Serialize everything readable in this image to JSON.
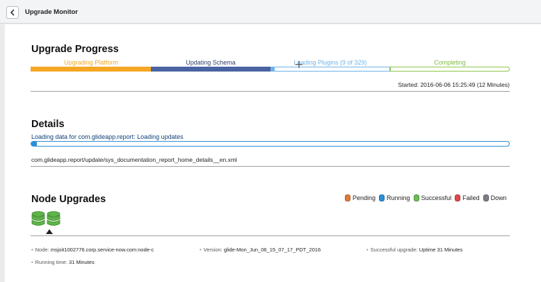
{
  "window": {
    "title": "Upgrade Monitor"
  },
  "progress": {
    "title": "Upgrade Progress",
    "phases": [
      {
        "label": "Upgrading Platform",
        "state": "done",
        "color": "#f5a623",
        "fill": 1.0
      },
      {
        "label": "Updating Schema",
        "state": "done",
        "color": "#4a64a3",
        "fill": 1.0
      },
      {
        "label": "Loading Plugins (9 of 329)",
        "state": "active",
        "color": "#6db3e8",
        "fill": 0.03
      },
      {
        "label": "Completing",
        "state": "pending",
        "color": "#8cc74a",
        "fill": 0.0
      }
    ],
    "started": "Started: 2016-06-06 15:25:49 (12 Minutes)"
  },
  "details": {
    "title": "Details",
    "status": "Loading data for com.glideapp.report: Loading updates",
    "progress": 0.012,
    "file": "com.glideapp.report/update/sys_documentation_report_home_details__en.xml"
  },
  "nodes": {
    "title": "Node Upgrades",
    "legend": [
      {
        "label": "Pending",
        "color": "#e07b3a"
      },
      {
        "label": "Running",
        "color": "#2b8fd6"
      },
      {
        "label": "Successful",
        "color": "#6bbf59"
      },
      {
        "label": "Failed",
        "color": "#e0474c"
      },
      {
        "label": "Down",
        "color": "#7b7f85"
      }
    ],
    "node_icon": "database-stack-icon",
    "node_label": "Node:",
    "node_value": "msjoit1002776.corp.service-now.com:node-c",
    "version_label": "Version:",
    "version_value": "glide-Mon_Jun_06_15_07_17_PDT_2016",
    "success_label": "Successful upgrade:",
    "success_value": "Uptime 31 Minutes",
    "runtime_label": "Running time:",
    "runtime_value": "31 Minutes"
  }
}
